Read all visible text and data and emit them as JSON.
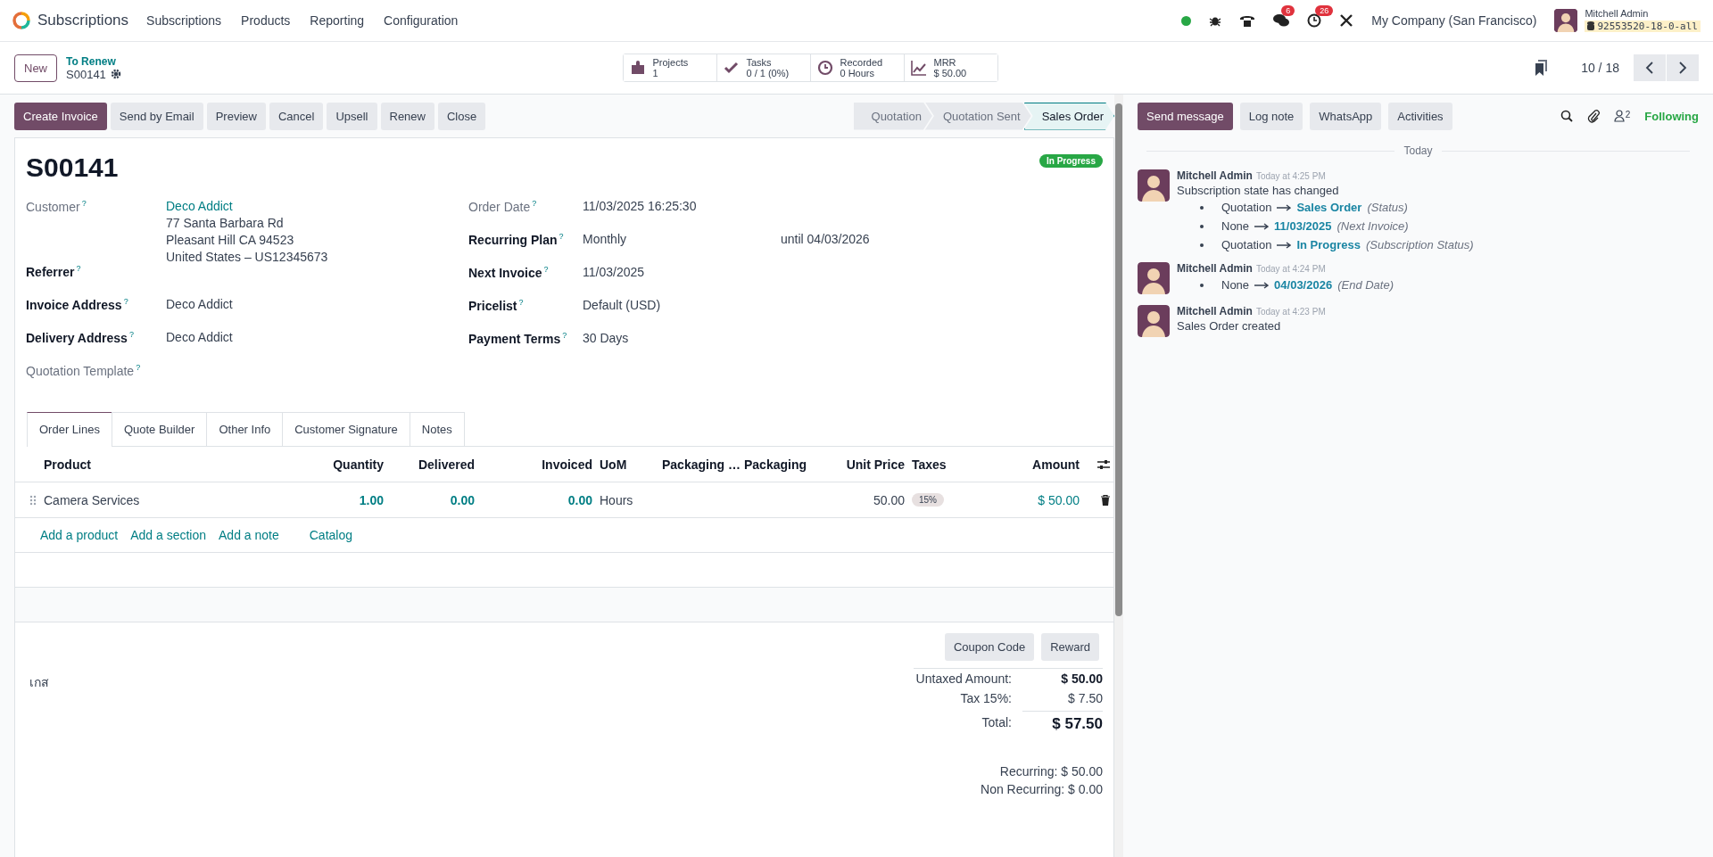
{
  "navbar": {
    "app_name": "Subscriptions",
    "menus": [
      "Subscriptions",
      "Products",
      "Reporting",
      "Configuration"
    ],
    "badges": {
      "messages": "6",
      "activities": "26"
    },
    "company": "My Company (San Francisco)",
    "user": {
      "name": "Mitchell Admin",
      "database": "92553520-18-0-all"
    }
  },
  "control_panel": {
    "new_button": "New",
    "breadcrumb": "To Renew",
    "record": "S00141",
    "smart_buttons": [
      {
        "label": "Projects",
        "value": "1"
      },
      {
        "label": "Tasks",
        "value": "0 / 1 (0%)"
      },
      {
        "label": "Recorded",
        "value": "0 Hours"
      },
      {
        "label": "MRR",
        "value": "$ 50.00"
      }
    ],
    "pager": "10 / 18"
  },
  "action_buttons": [
    {
      "label": "Create Invoice",
      "primary": true
    },
    {
      "label": "Send by Email",
      "primary": false
    },
    {
      "label": "Preview",
      "primary": false
    },
    {
      "label": "Cancel",
      "primary": false
    },
    {
      "label": "Upsell",
      "primary": false
    },
    {
      "label": "Renew",
      "primary": false
    },
    {
      "label": "Close",
      "primary": false
    }
  ],
  "statusbar": [
    {
      "label": "Quotation",
      "selected": false
    },
    {
      "label": "Quotation Sent",
      "selected": false
    },
    {
      "label": "Sales Order",
      "selected": true
    }
  ],
  "form": {
    "title": "S00141",
    "status_badge": "In Progress",
    "left_fields": [
      {
        "label": "Customer",
        "help": "?",
        "required": false,
        "value": "Deco Addict",
        "link": true,
        "address": [
          "77 Santa Barbara Rd",
          "Pleasant Hill CA 94523",
          "United States – US12345673"
        ]
      },
      {
        "label": "Referrer",
        "help": "?",
        "required": true
      },
      {
        "label": "Invoice Address",
        "help": "?",
        "required": true,
        "value": "Deco Addict",
        "link": false
      },
      {
        "label": "Delivery Address",
        "help": "?",
        "required": true,
        "value": "Deco Addict",
        "link": false
      },
      {
        "label": "Quotation Template",
        "help": "?",
        "required": false
      }
    ],
    "right_fields": [
      {
        "label": "Order Date",
        "help": "?",
        "required": false,
        "value": "11/03/2025 16:25:30"
      },
      {
        "label": "Recurring Plan",
        "help": "?",
        "required": true,
        "value": "Monthly",
        "extra": "until 04/03/2026"
      },
      {
        "label": "Next Invoice",
        "help": "?",
        "required": true,
        "value": "11/03/2025"
      },
      {
        "label": "Pricelist",
        "help": "?",
        "required": true,
        "value": "Default (USD)"
      },
      {
        "label": "Payment Terms",
        "help": "?",
        "required": true,
        "value": "30 Days"
      }
    ],
    "tabs": [
      {
        "label": "Order Lines",
        "selected": true
      },
      {
        "label": "Quote Builder",
        "selected": false
      },
      {
        "label": "Other Info",
        "selected": false
      },
      {
        "label": "Customer Signature",
        "selected": false
      },
      {
        "label": "Notes",
        "selected": false
      }
    ],
    "table": {
      "columns": [
        "Product",
        "Quantity",
        "Delivered",
        "Invoiced",
        "UoM",
        "Packaging …",
        "Packaging",
        "Unit Price",
        "Taxes",
        "Amount"
      ],
      "rows": [
        {
          "product": "Camera Services",
          "quantity": "1.00",
          "delivered": "0.00",
          "invoiced": "0.00",
          "uom": "Hours",
          "unit_price": "50.00",
          "taxes": [
            "15%"
          ],
          "amount": "$ 50.00"
        }
      ],
      "add_links": [
        "Add a product",
        "Add a section",
        "Add a note",
        "Catalog"
      ]
    },
    "promo_buttons": [
      "Coupon Code",
      "Reward"
    ],
    "note": "เกส",
    "totals": [
      {
        "label": "Untaxed Amount:",
        "value": "$ 50.00",
        "kind": "subtotal"
      },
      {
        "label": "Tax 15%:",
        "value": "$ 7.50",
        "kind": "tax"
      },
      {
        "label": "Total:",
        "value": "$ 57.50",
        "kind": "total"
      }
    ],
    "recurring": [
      "Recurring: $ 50.00",
      "Non Recurring: $ 0.00"
    ]
  },
  "chatter": {
    "buttons": [
      {
        "label": "Send message",
        "primary": true
      },
      {
        "label": "Log note",
        "primary": false
      },
      {
        "label": "WhatsApp",
        "primary": false
      },
      {
        "label": "Activities",
        "primary": false
      }
    ],
    "followers_count": "2",
    "follow_label": "Following",
    "separator": "Today",
    "messages": [
      {
        "author": "Mitchell Admin",
        "time": "Today at 4:25 PM",
        "body": "Subscription state has changed",
        "changes": [
          {
            "old": "Quotation",
            "new": "Sales Order",
            "field": "(Status)"
          },
          {
            "old": "None",
            "new": "11/03/2025",
            "field": "(Next Invoice)"
          },
          {
            "old": "Quotation",
            "new": "In Progress",
            "field": "(Subscription Status)"
          }
        ]
      },
      {
        "author": "Mitchell Admin",
        "time": "Today at 4:24 PM",
        "changes": [
          {
            "old": "None",
            "new": "04/03/2026",
            "field": "(End Date)"
          }
        ]
      },
      {
        "author": "Mitchell Admin",
        "time": "Today at 4:23 PM",
        "body": "Sales Order created"
      }
    ]
  }
}
